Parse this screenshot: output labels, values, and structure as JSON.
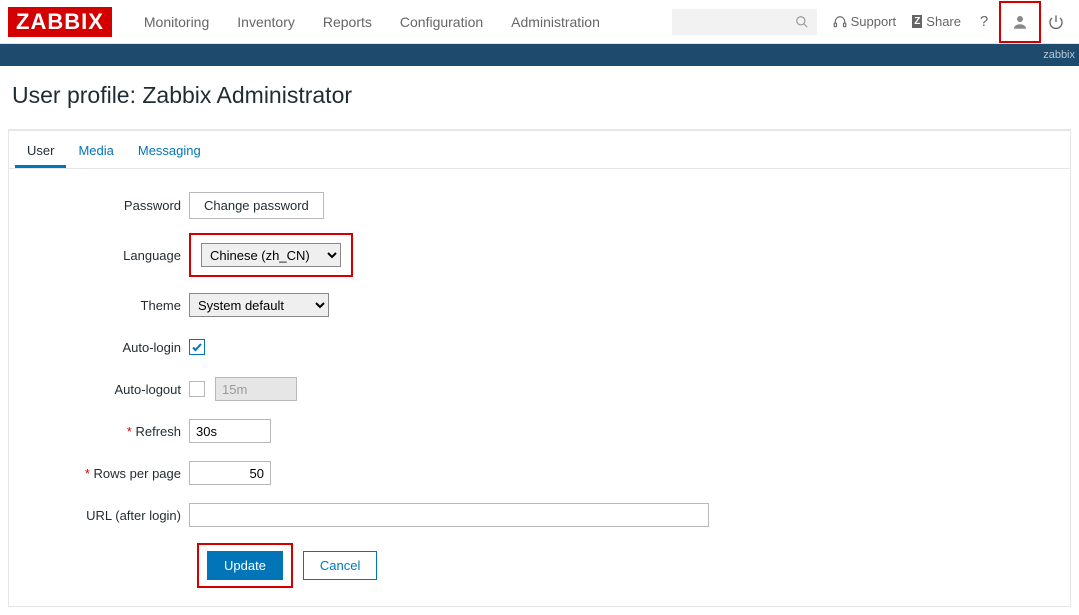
{
  "brand": "ZABBIX",
  "nav": [
    "Monitoring",
    "Inventory",
    "Reports",
    "Configuration",
    "Administration"
  ],
  "right": {
    "support": "Support",
    "share": "Share",
    "user_tag": "zabbix"
  },
  "page_title": "User profile: Zabbix Administrator",
  "tabs": [
    "User",
    "Media",
    "Messaging"
  ],
  "active_tab": 0,
  "form": {
    "password_label": "Password",
    "change_password": "Change password",
    "language_label": "Language",
    "language_value": "Chinese (zh_CN)",
    "theme_label": "Theme",
    "theme_value": "System default",
    "auto_login_label": "Auto-login",
    "auto_login_checked": true,
    "auto_logout_label": "Auto-logout",
    "auto_logout_checked": false,
    "auto_logout_value": "15m",
    "refresh_label": "Refresh",
    "refresh_value": "30s",
    "rows_label": "Rows per page",
    "rows_value": "50",
    "url_label": "URL (after login)",
    "url_value": ""
  },
  "actions": {
    "update": "Update",
    "cancel": "Cancel"
  }
}
